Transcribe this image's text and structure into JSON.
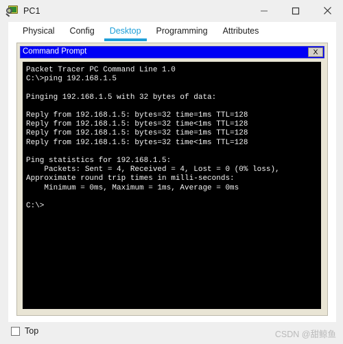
{
  "window": {
    "title": "PC1",
    "icon": "pc-device-icon",
    "controls": {
      "minimize": "minimize-icon",
      "maximize": "maximize-icon",
      "close": "close-icon"
    }
  },
  "tabs": [
    {
      "label": "Physical",
      "active": false
    },
    {
      "label": "Config",
      "active": false
    },
    {
      "label": "Desktop",
      "active": true
    },
    {
      "label": "Programming",
      "active": false
    },
    {
      "label": "Attributes",
      "active": false
    }
  ],
  "command_prompt": {
    "title": "Command Prompt",
    "close_label": "X",
    "title_bg": "#0000f5",
    "terminal_bg": "#000000",
    "terminal_fg": "#f2f2f2",
    "lines": [
      "Packet Tracer PC Command Line 1.0",
      "C:\\>ping 192.168.1.5",
      "",
      "Pinging 192.168.1.5 with 32 bytes of data:",
      "",
      "Reply from 192.168.1.5: bytes=32 time=1ms TTL=128",
      "Reply from 192.168.1.5: bytes=32 time<1ms TTL=128",
      "Reply from 192.168.1.5: bytes=32 time=1ms TTL=128",
      "Reply from 192.168.1.5: bytes=32 time<1ms TTL=128",
      "",
      "Ping statistics for 192.168.1.5:",
      "    Packets: Sent = 4, Received = 4, Lost = 0 (0% loss),",
      "Approximate round trip times in milli-seconds:",
      "    Minimum = 0ms, Maximum = 1ms, Average = 0ms",
      "",
      "C:\\>"
    ]
  },
  "bottom": {
    "top_checkbox_label": "Top",
    "top_checkbox_checked": false,
    "watermark": "CSDN @甜鲸鱼"
  },
  "colors": {
    "accent": "#1e9fd8",
    "panel_bg": "#ffffff",
    "window_bg": "#efefef",
    "frame_beige": "#e9e5d5"
  }
}
